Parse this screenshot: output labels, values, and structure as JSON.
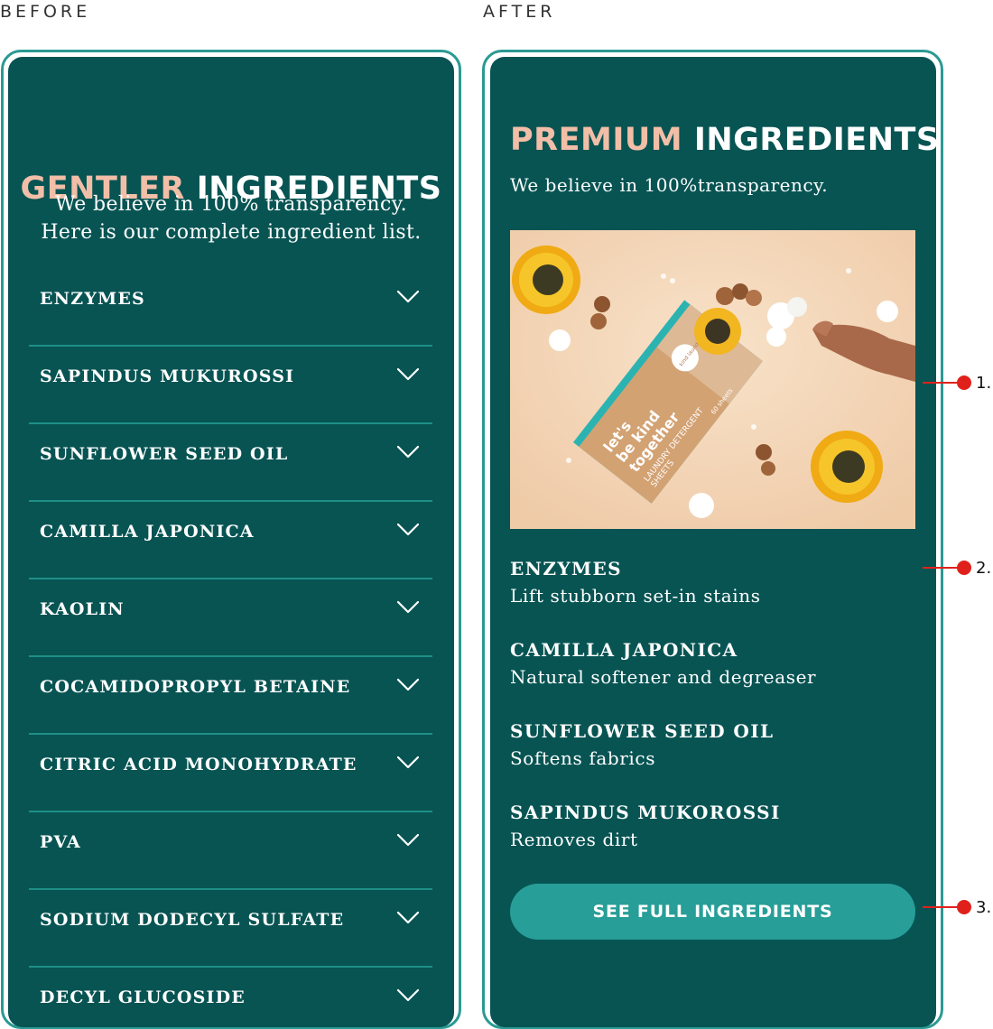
{
  "labels": {
    "before": "BEFORE",
    "after": "AFTER"
  },
  "colors": {
    "panel": "#075453",
    "accent": "#f2bea7",
    "divider": "#1e8f86",
    "cta": "#279e98",
    "callout": "#e0211b"
  },
  "before": {
    "heading_accent": "GENTLER",
    "heading_rest": "INGREDIENTS",
    "intro_line1": "We believe in 100% transparency.",
    "intro_line2": "Here is our complete ingredient list.",
    "accordion": [
      "ENZYMES",
      "SAPINDUS MUKUROSSI",
      "SUNFLOWER SEED OIL",
      "CAMILLA JAPONICA",
      "KAOLIN",
      "COCAMIDOPROPYL BETAINE",
      "CITRIC ACID MONOHYDRATE",
      "PVA",
      "SODIUM DODECYL SULFATE",
      "DECYL GLUCOSIDE"
    ],
    "chevron_icon": "chevron-down-icon"
  },
  "after": {
    "heading_accent": "PREMIUM",
    "heading_rest": "INGREDIENTS",
    "intro": "We believe in 100%transparency.",
    "image": {
      "box_text_1": "let's",
      "box_text_2": "be kind",
      "box_text_3": "together",
      "box_text_4": "LAUNDRY DETERGENT",
      "box_text_5": "SHEETS",
      "box_text_6": "60 sheets",
      "brand": "kind laundry"
    },
    "ingredients": [
      {
        "name": "ENZYMES",
        "desc": "Lift stubborn set-in stains"
      },
      {
        "name": "CAMILLA JAPONICA",
        "desc": "Natural softener and degreaser"
      },
      {
        "name": "SUNFLOWER SEED OIL",
        "desc": "Softens fabrics"
      },
      {
        "name": "SAPINDUS MUKOROSSI",
        "desc": "Removes dirt"
      }
    ],
    "cta": "SEE FULL INGREDIENTS"
  },
  "callouts": [
    "1.",
    "2.",
    "3."
  ]
}
